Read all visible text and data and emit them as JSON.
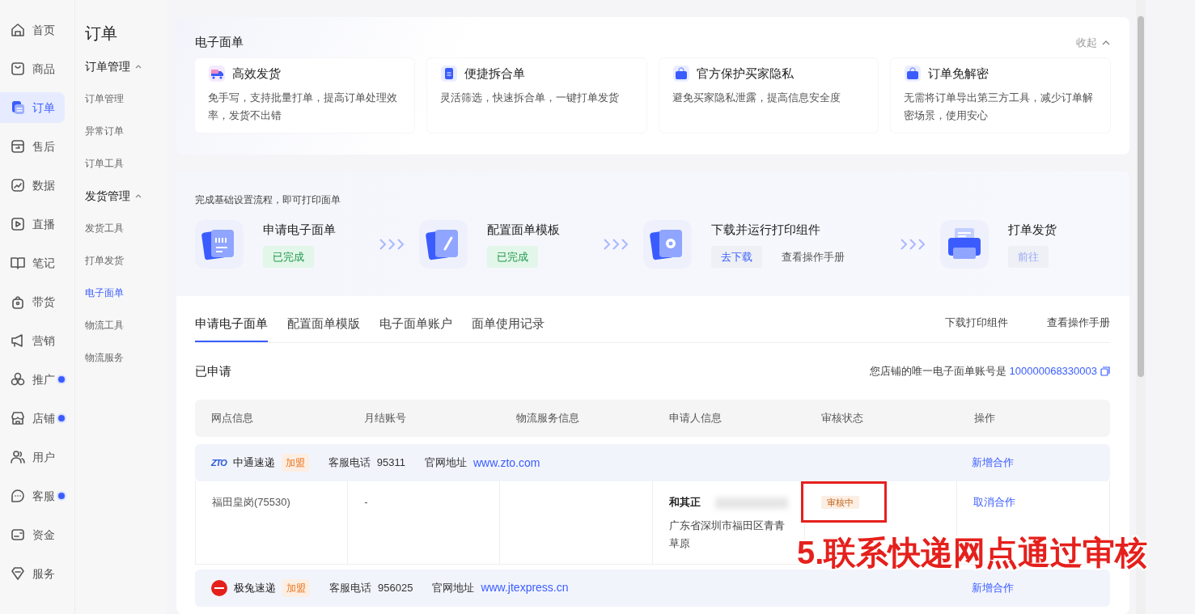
{
  "nav": [
    {
      "label": "首页",
      "selected": false,
      "dot": false
    },
    {
      "label": "商品",
      "selected": false,
      "dot": false
    },
    {
      "label": "订单",
      "selected": true,
      "dot": false
    },
    {
      "label": "售后",
      "selected": false,
      "dot": false
    },
    {
      "label": "数据",
      "selected": false,
      "dot": false
    },
    {
      "label": "直播",
      "selected": false,
      "dot": false
    },
    {
      "label": "笔记",
      "selected": false,
      "dot": false
    },
    {
      "label": "带货",
      "selected": false,
      "dot": false
    },
    {
      "label": "营销",
      "selected": false,
      "dot": false
    },
    {
      "label": "推广",
      "selected": false,
      "dot": true
    },
    {
      "label": "店铺",
      "selected": false,
      "dot": true
    },
    {
      "label": "用户",
      "selected": false,
      "dot": false
    },
    {
      "label": "客服",
      "selected": false,
      "dot": true
    },
    {
      "label": "资金",
      "selected": false,
      "dot": false
    },
    {
      "label": "服务",
      "selected": false,
      "dot": false
    }
  ],
  "subnav": {
    "title": "订单",
    "groups": [
      {
        "label": "订单管理",
        "expanded": true,
        "items": [
          {
            "label": "订单管理",
            "selected": false
          },
          {
            "label": "异常订单",
            "selected": false
          },
          {
            "label": "订单工具",
            "selected": false
          }
        ]
      },
      {
        "label": "发货管理",
        "expanded": true,
        "items": [
          {
            "label": "发货工具",
            "selected": false
          },
          {
            "label": "打单发货",
            "selected": false
          },
          {
            "label": "电子面单",
            "selected": true
          },
          {
            "label": "物流工具",
            "selected": false
          },
          {
            "label": "物流服务",
            "selected": false
          }
        ]
      }
    ]
  },
  "intro": {
    "title": "电子面单",
    "collapse": "收起",
    "features": [
      {
        "title": "高效发货",
        "desc": "免手写，支持批量打单，提高订单处理效率，发货不出错"
      },
      {
        "title": "便捷拆合单",
        "desc": "灵活筛选，快速拆合单，一键打单发货"
      },
      {
        "title": "官方保护买家隐私",
        "desc": "避免买家隐私泄露，提高信息安全度"
      },
      {
        "title": "订单免解密",
        "desc": "无需将订单导出第三方工具，减少订单解密场景，使用安心"
      }
    ]
  },
  "setup": {
    "hint": "完成基础设置流程，即可打印面单",
    "steps": [
      {
        "title": "申请电子面单",
        "actions": [
          {
            "label": "已完成",
            "kind": "done"
          }
        ]
      },
      {
        "title": "配置面单模板",
        "actions": [
          {
            "label": "已完成",
            "kind": "done"
          }
        ]
      },
      {
        "title": "下载并运行打印组件",
        "actions": [
          {
            "label": "去下载",
            "kind": "button"
          },
          {
            "label": "查看操作手册",
            "kind": "link"
          }
        ]
      },
      {
        "title": "打单发货",
        "actions": [
          {
            "label": "前往",
            "kind": "disabled"
          }
        ]
      }
    ]
  },
  "tabs": [
    {
      "label": "申请电子面单",
      "selected": true
    },
    {
      "label": "配置面单模版",
      "selected": false
    },
    {
      "label": "电子面单账户",
      "selected": false
    },
    {
      "label": "面单使用记录",
      "selected": false
    }
  ],
  "tab_links": [
    "下载打印组件",
    "查看操作手册"
  ],
  "applied": {
    "title": "已申请",
    "account_label": "您店铺的唯一电子面单账号是",
    "account": "100000068330003"
  },
  "table": {
    "columns": [
      "网点信息",
      "月结账号",
      "物流服务信息",
      "申请人信息",
      "审核状态",
      "操作"
    ],
    "groups": [
      {
        "logo": {
          "kind": "text",
          "text": "ZTO"
        },
        "carrier": "中通速递",
        "tag": "加盟",
        "phone_label": "客服电话",
        "phone": "95311",
        "site_label": "官网地址",
        "site": "www.zto.com",
        "action": "新增合作",
        "rows": [
          {
            "branch": "福田皇岗(75530)",
            "monthly_account": "-",
            "applicant_name": "和其正",
            "applicant_address": "广东省深圳市福田区青青草原",
            "status": "审核中",
            "action": "取消合作",
            "highlighted": true
          }
        ]
      },
      {
        "logo": {
          "kind": "badge"
        },
        "carrier": "极兔速递",
        "tag": "加盟",
        "phone_label": "客服电话",
        "phone": "956025",
        "site_label": "官网地址",
        "site": "www.jtexpress.cn",
        "action": "新增合作"
      }
    ]
  },
  "annotation": "5.联系快递网点通过审核"
}
